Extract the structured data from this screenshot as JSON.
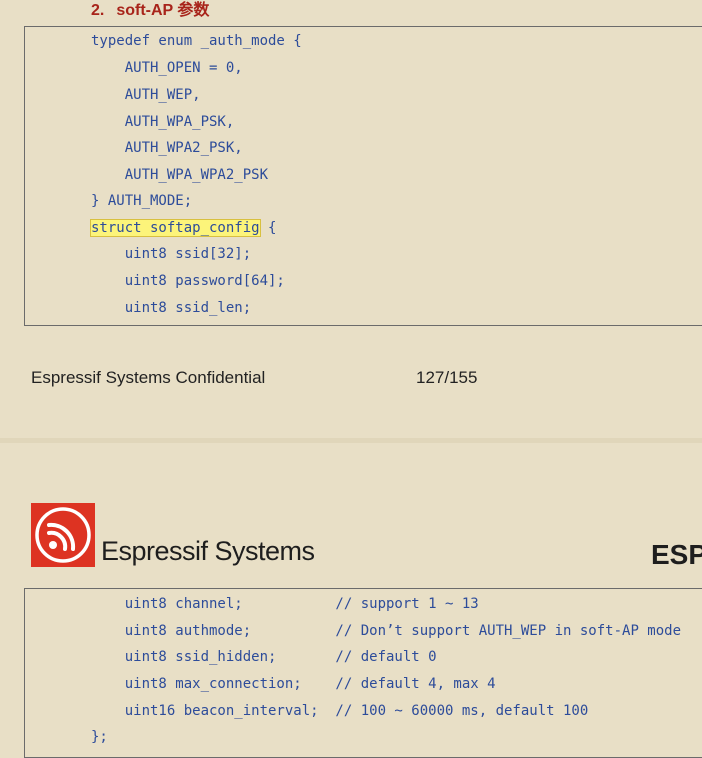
{
  "section": {
    "number": "2.",
    "title": "soft-AP 参数"
  },
  "code_top": [
    {
      "text": "typedef enum _auth_mode {"
    },
    {
      "text": "    AUTH_OPEN = 0,"
    },
    {
      "text": "    AUTH_WEP,"
    },
    {
      "text": "    AUTH_WPA_PSK,"
    },
    {
      "text": "    AUTH_WPA2_PSK,"
    },
    {
      "text": "    AUTH_WPA_WPA2_PSK"
    },
    {
      "text": "} AUTH_MODE;"
    },
    {
      "highlight": "struct softap_config",
      "text": " {"
    },
    {
      "text": "    uint8 ssid[32];"
    },
    {
      "text": "    uint8 password[64];"
    },
    {
      "text": "    uint8 ssid_len;"
    }
  ],
  "footer": {
    "left": "Espressif Systems Confidential",
    "page": "127/155"
  },
  "header": {
    "company": "Espressif Systems",
    "right_cut": "ESP"
  },
  "code_bottom": [
    {
      "text": "    uint8 channel;           // support 1 ~ 13"
    },
    {
      "text": "    uint8 authmode;          // Don’t support AUTH_WEP in soft-AP mode"
    },
    {
      "text": "    uint8 ssid_hidden;       // default 0"
    },
    {
      "text": "    uint8 max_connection;    // default 4, max 4"
    },
    {
      "text": "    uint16 beacon_interval;  // 100 ~ 60000 ms, default 100"
    },
    {
      "text": "};"
    }
  ],
  "colors": {
    "background": "#e8dfc6",
    "code": "#2d4c9a",
    "heading": "#a8241a",
    "logo": "#dd3322",
    "highlight": "#fcf47a"
  },
  "icons": {
    "logo": "espressif-logo-icon"
  }
}
